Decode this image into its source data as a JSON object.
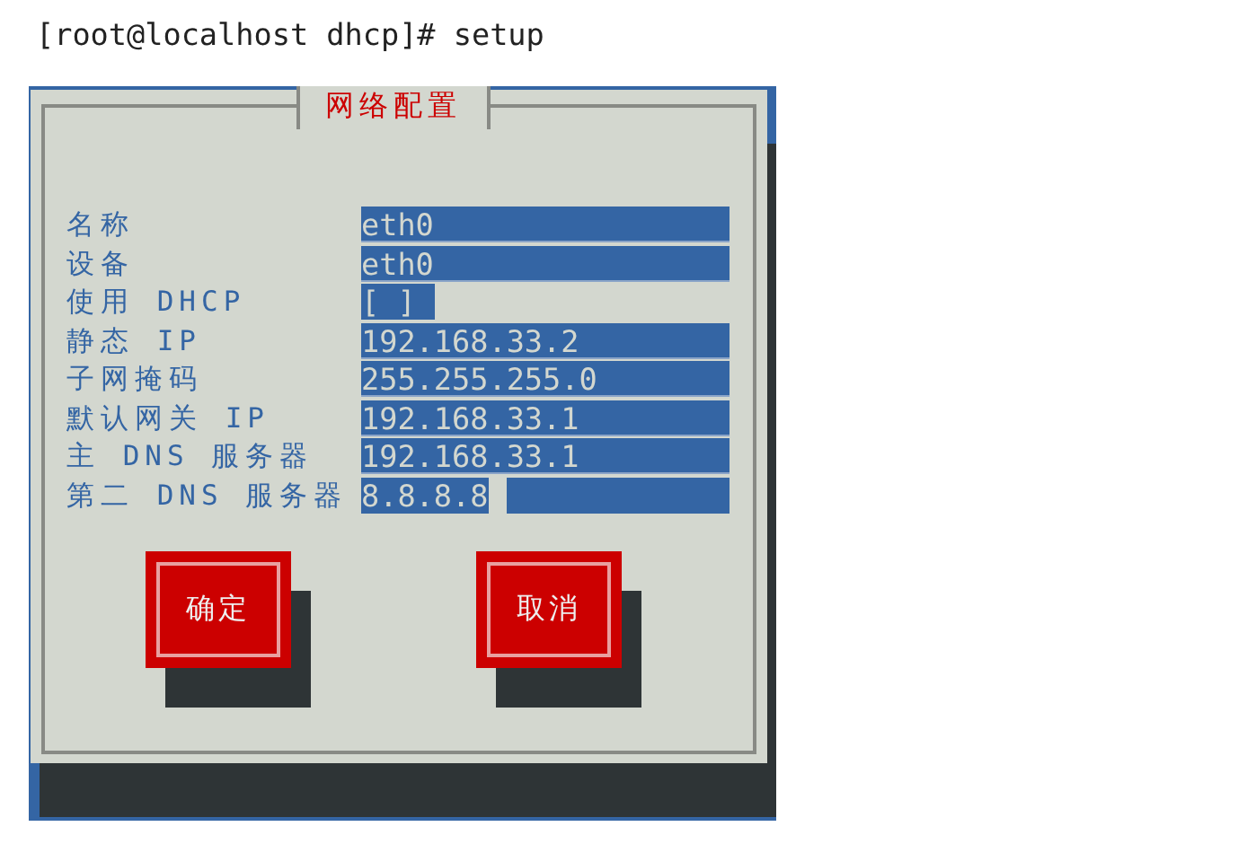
{
  "terminal": {
    "prompt": "[root@localhost dhcp]# setup"
  },
  "dialog": {
    "title": "网络配置",
    "fields": [
      {
        "label": "名称",
        "kind": "text",
        "value": "eth0",
        "focused": false
      },
      {
        "label": "设备",
        "kind": "text",
        "value": "eth0",
        "focused": false
      },
      {
        "label": "使用 DHCP",
        "kind": "checkbox",
        "value": "[ ]",
        "checked": false,
        "focused": false
      },
      {
        "label": "静态 IP",
        "kind": "text",
        "value": "192.168.33.2",
        "focused": false
      },
      {
        "label": "子网掩码",
        "kind": "text",
        "value": "255.255.255.0",
        "focused": false
      },
      {
        "label": "默认网关 IP",
        "kind": "text",
        "value": "192.168.33.1",
        "focused": false
      },
      {
        "label": "主 DNS 服务器",
        "kind": "text",
        "value": "192.168.33.1",
        "focused": false
      },
      {
        "label": "第二 DNS 服务器",
        "kind": "text",
        "value": "8.8.8.8",
        "focused": true
      }
    ],
    "buttons": [
      "确定",
      "取消"
    ]
  }
}
